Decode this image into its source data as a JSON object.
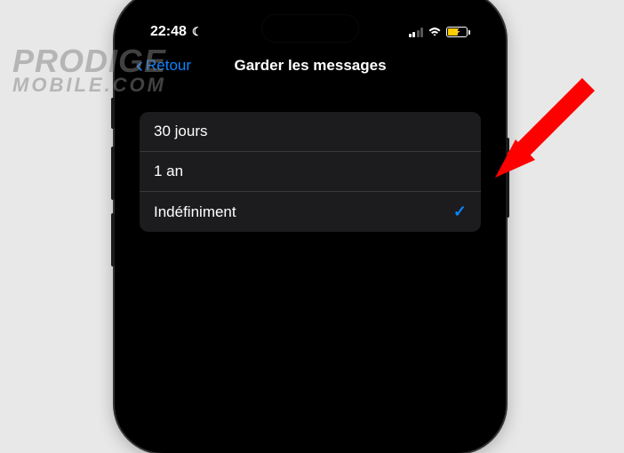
{
  "status": {
    "time": "22:48",
    "moon_icon": "☾"
  },
  "nav": {
    "back_label": "Retour",
    "title": "Garder les messages"
  },
  "options": [
    {
      "label": "30 jours",
      "selected": false
    },
    {
      "label": "1 an",
      "selected": false
    },
    {
      "label": "Indéfiniment",
      "selected": true
    }
  ],
  "watermark": {
    "line1": "PRODIGE",
    "line2": "MOBILE.COM"
  }
}
